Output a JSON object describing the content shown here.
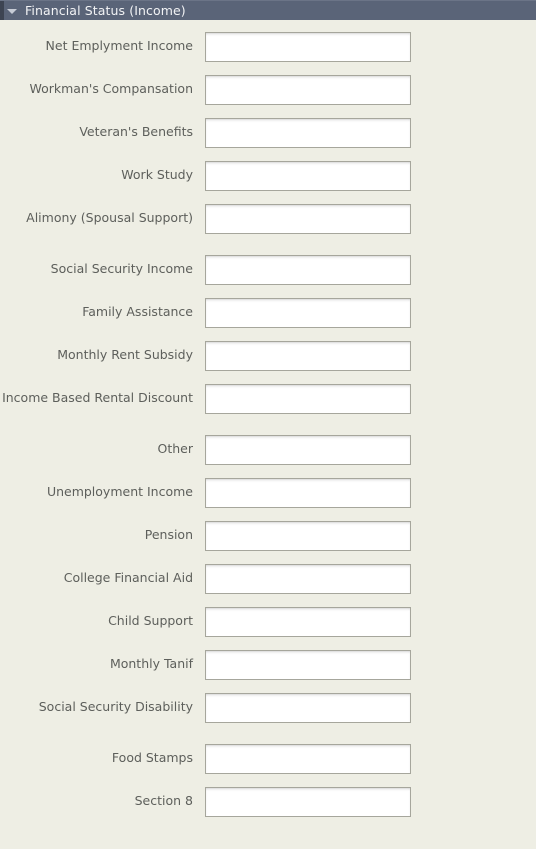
{
  "section": {
    "title": "Financial Status (Income)",
    "collapse_icon": "chevron-down-icon",
    "expanded": true,
    "header_bg": "#5a6478",
    "header_text_color": "#f2f3f5",
    "panel_bg": "#eeeee4",
    "label_color": "#5d5f5b",
    "input_bg": "#ffffff",
    "input_border": "#a6a69c"
  },
  "fields": [
    {
      "label": "Net Emplyment Income",
      "value": "",
      "placeholder": ""
    },
    {
      "label": "Workman's Compansation",
      "value": "",
      "placeholder": ""
    },
    {
      "label": "Veteran's Benefits",
      "value": "",
      "placeholder": ""
    },
    {
      "label": "Work Study",
      "value": "",
      "placeholder": ""
    },
    {
      "label": "Alimony (Spousal Support)",
      "value": "",
      "placeholder": ""
    },
    {
      "label": "Social Security Income",
      "value": "",
      "placeholder": ""
    },
    {
      "label": "Family Assistance",
      "value": "",
      "placeholder": ""
    },
    {
      "label": "Monthly Rent Subsidy",
      "value": "",
      "placeholder": ""
    },
    {
      "label": "Income Based Rental Discount",
      "value": "",
      "placeholder": ""
    },
    {
      "label": "Other",
      "value": "",
      "placeholder": ""
    },
    {
      "label": "Unemployment Income",
      "value": "",
      "placeholder": ""
    },
    {
      "label": "Pension",
      "value": "",
      "placeholder": ""
    },
    {
      "label": "College Financial Aid",
      "value": "",
      "placeholder": ""
    },
    {
      "label": "Child Support",
      "value": "",
      "placeholder": ""
    },
    {
      "label": "Monthly Tanif",
      "value": "",
      "placeholder": ""
    },
    {
      "label": "Social Security Disability",
      "value": "",
      "placeholder": ""
    },
    {
      "label": "Food Stamps",
      "value": "",
      "placeholder": ""
    },
    {
      "label": "Section 8",
      "value": "",
      "placeholder": ""
    }
  ]
}
